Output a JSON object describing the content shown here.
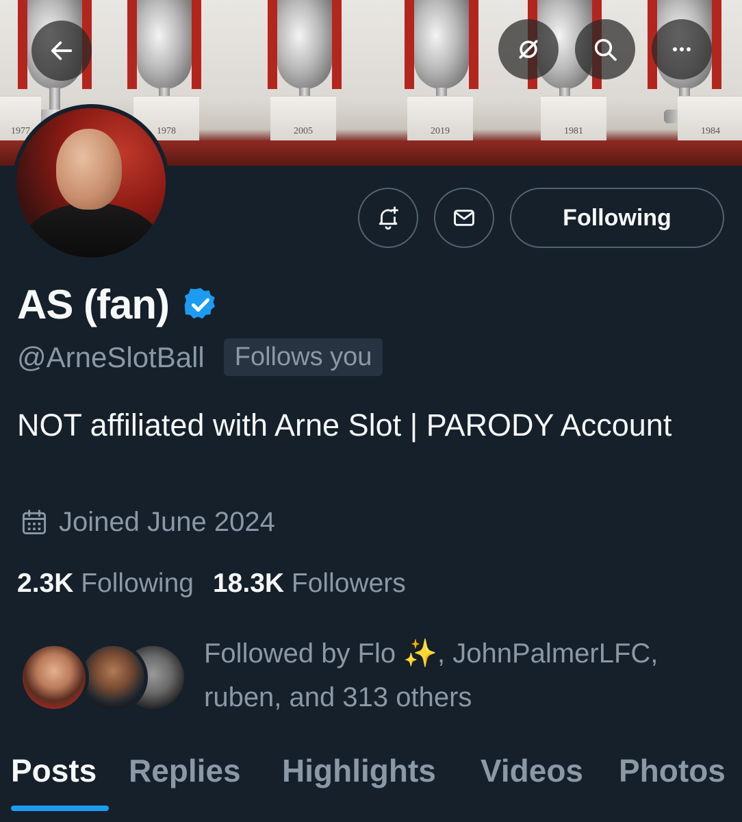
{
  "banner": {
    "plinth_years": [
      "1977",
      "1978",
      "2005",
      "2019",
      "1981",
      "1984"
    ]
  },
  "profile": {
    "display_name": "AS (fan)",
    "handle": "@ArneSlotBall",
    "follows_you": "Follows you",
    "bio": "NOT affiliated with Arne Slot | PARODY Account",
    "joined": "Joined June 2024",
    "following_count": "2.3K",
    "following_label": "Following",
    "followers_count": "18.3K",
    "followers_label": "Followers",
    "followed_by": "Followed by Flo ✨, JohnPalmerLFC, ruben, and 313 others"
  },
  "actions": {
    "following_button": "Following"
  },
  "tabs": [
    {
      "label": "Posts"
    },
    {
      "label": "Replies"
    },
    {
      "label": "Highlights"
    },
    {
      "label": "Videos"
    },
    {
      "label": "Photos"
    }
  ],
  "colors": {
    "background": "#15202b",
    "accent": "#1d9bf0",
    "secondary_text": "#8b98a5",
    "verified": "#1d9bf0"
  },
  "icons": [
    "back-arrow-icon",
    "unfollow-icon",
    "search-icon",
    "more-icon",
    "bell-plus-icon",
    "mail-icon",
    "verified-badge-icon",
    "calendar-icon"
  ]
}
